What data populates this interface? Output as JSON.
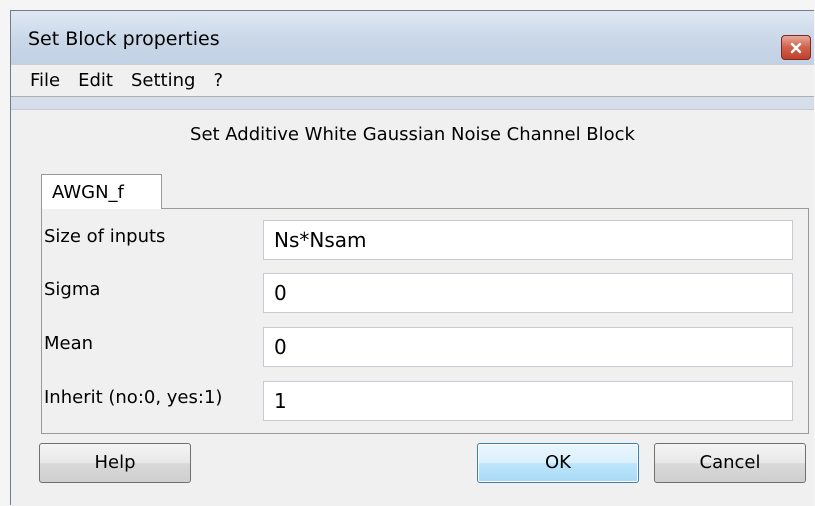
{
  "window": {
    "title": "Set Block properties"
  },
  "menu": {
    "items": [
      "File",
      "Edit",
      "Setting",
      "?"
    ]
  },
  "dialog": {
    "header": "Set Additive White Gaussian Noise Channel Block",
    "tab_label": "AWGN_f",
    "fields": [
      {
        "label": "Size of inputs",
        "value": "Ns*Nsam"
      },
      {
        "label": "Sigma",
        "value": "0"
      },
      {
        "label": "Mean",
        "value": "0"
      },
      {
        "label": "Inherit (no:0, yes:1)",
        "value": "1"
      }
    ]
  },
  "buttons": {
    "help": "Help",
    "ok": "OK",
    "cancel": "Cancel"
  },
  "icons": {
    "close": "close-icon"
  },
  "colors": {
    "close_button": "#c0402c",
    "ok_border": "#3c7fb1"
  }
}
